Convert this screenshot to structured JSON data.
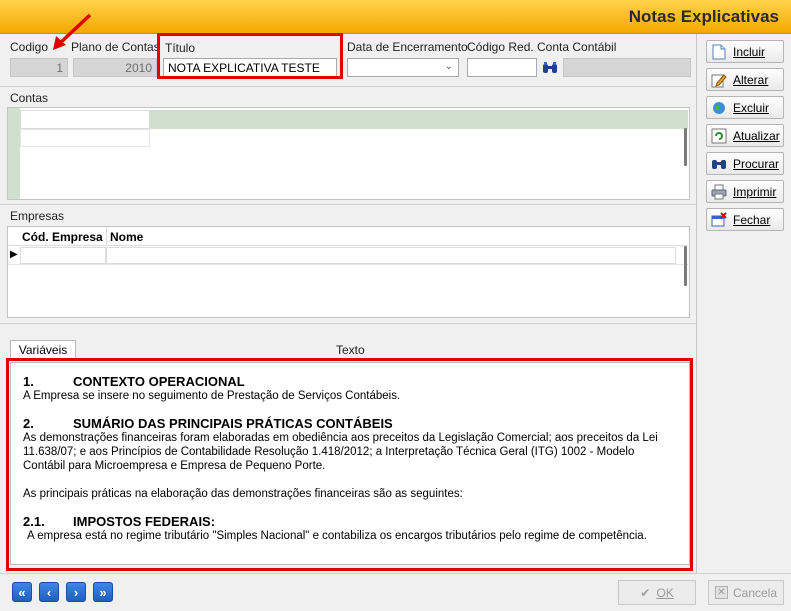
{
  "window": {
    "title": "Notas Explicativas"
  },
  "header": {
    "codigo_label": "Codigo",
    "codigo_value": "1",
    "plano_label": "Plano de Contas",
    "plano_value": "2010",
    "titulo_label": "Título",
    "titulo_value": "NOTA EXPLICATIVA TESTE",
    "data_encerramento_label": "Data de Encerramento",
    "codigo_red_label": "Código Red.",
    "conta_contabil_label": "Conta Contábil"
  },
  "contas": {
    "label": "Contas"
  },
  "empresas": {
    "label": "Empresas",
    "columns": [
      "Cód. Empresa",
      "Nome"
    ]
  },
  "texto": {
    "tab_label": "Variáveis",
    "label": "Texto",
    "s1_num": "1.",
    "s1_title": "CONTEXTO OPERACIONAL",
    "s1_p1": "A Empresa se insere no seguimento de Prestação de Serviços Contábeis.",
    "s2_num": "2.",
    "s2_title": "SUMÁRIO DAS PRINCIPAIS PRÁTICAS CONTÁBEIS",
    "s2_p1": "As demonstrações financeiras foram elaboradas em obediência aos preceitos da Legislação Comercial; aos preceitos da Lei 11.638/07; e aos Princípios de Contabilidade Resolução 1.418/2012; a Interpretação Técnica Geral (ITG) 1002 - Modelo Contábil para Microempresa e Empresa de Pequeno Porte.",
    "s2_p2": "As principais práticas na elaboração das demonstrações financeiras são as seguintes:",
    "s21_num": "2.1.",
    "s21_title": "IMPOSTOS FEDERAIS:",
    "s21_p1": "A empresa está no regime tributário \"Simples Nacional\" e contabiliza os encargos tributários pelo regime de competência."
  },
  "sidebar": {
    "incluir": "Incluir",
    "alterar": "Alterar",
    "excluir": "Excluir",
    "atualizar": "Atualizar",
    "procurar": "Procurar",
    "imprimir": "Imprimir",
    "fechar": "Fechar"
  },
  "footer": {
    "ok": "OK",
    "cancela": "Cancela"
  },
  "colors": {
    "title_bar": "#f5a800",
    "highlight_red": "#e00000",
    "nav_blue": "#1f5fc0"
  }
}
